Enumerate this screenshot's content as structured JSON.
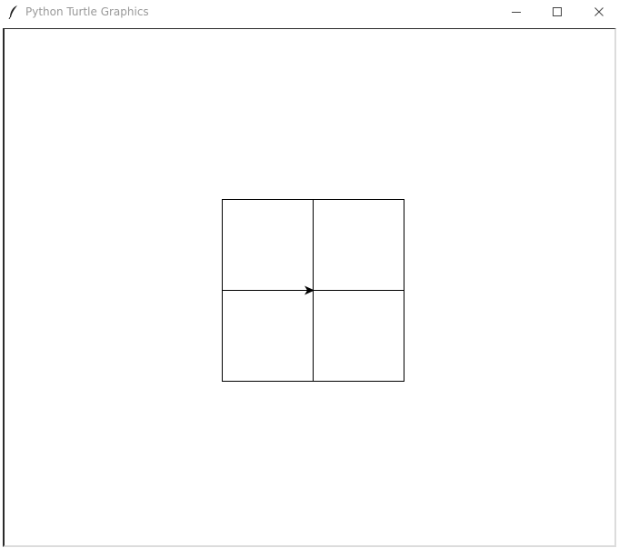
{
  "window": {
    "title": "Python Turtle Graphics",
    "app_icon": "feather-icon",
    "controls": {
      "minimize_icon": "minimize-icon",
      "maximize_icon": "maximize-icon",
      "close_icon": "close-icon"
    }
  },
  "canvas": {
    "background": "#ffffff",
    "pen_color": "#000000",
    "drawing": {
      "shape": "square grid",
      "rows": 2,
      "columns": 2
    },
    "turtle": {
      "shape": "arrow",
      "heading": "east",
      "color": "#000000"
    }
  }
}
